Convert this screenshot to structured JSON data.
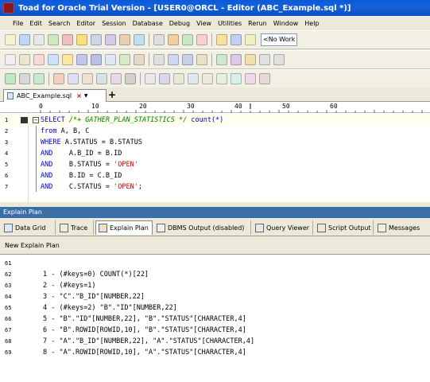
{
  "window": {
    "title": "Toad for Oracle Trial Version - [USER0@ORCL - Editor (ABC_Example.sql *)]"
  },
  "menu": [
    "File",
    "Edit",
    "Search",
    "Editor",
    "Session",
    "Database",
    "Debug",
    "View",
    "Utilities",
    "Rerun",
    "Window",
    "Help"
  ],
  "toolbar": {
    "workspace_label": "<No Work"
  },
  "document_tab": {
    "label": "ABC_Example.sql",
    "close_icon": "×",
    "dropdown": "▼",
    "add_label": "+"
  },
  "ruler": {
    "ticks": [
      "0",
      "10",
      "20",
      "30",
      "40",
      "50",
      "60"
    ]
  },
  "editor": {
    "lines": [
      {
        "n": "1",
        "segments": [
          {
            "t": "SELECT ",
            "c": "kw"
          },
          {
            "t": "/*+ GATHER_PLAN_STATISTICS */",
            "c": "cm"
          },
          {
            "t": " count(*)",
            "c": "kw"
          }
        ]
      },
      {
        "n": "2",
        "segments": [
          {
            "t": "from ",
            "c": "kw"
          },
          {
            "t": "A, B, C",
            "c": ""
          }
        ]
      },
      {
        "n": "3",
        "segments": [
          {
            "t": "WHERE ",
            "c": "kw"
          },
          {
            "t": "A.STATUS = B.STATUS",
            "c": ""
          }
        ]
      },
      {
        "n": "4",
        "segments": [
          {
            "t": "AND    ",
            "c": "kw"
          },
          {
            "t": "A.B_ID = B.ID",
            "c": ""
          }
        ]
      },
      {
        "n": "5",
        "segments": [
          {
            "t": "AND    ",
            "c": "kw"
          },
          {
            "t": "B.STATUS = ",
            "c": ""
          },
          {
            "t": "'OPEN'",
            "c": "str"
          }
        ]
      },
      {
        "n": "6",
        "segments": [
          {
            "t": "AND    ",
            "c": "kw"
          },
          {
            "t": "B.ID = C.B_ID",
            "c": ""
          }
        ]
      },
      {
        "n": "7",
        "segments": [
          {
            "t": "AND    ",
            "c": "kw"
          },
          {
            "t": "C.STATUS = ",
            "c": ""
          },
          {
            "t": "'OPEN'",
            "c": "str"
          },
          {
            "t": ";",
            "c": ""
          }
        ]
      }
    ]
  },
  "panel": {
    "title": "Explain Plan",
    "tabs": [
      "Data Grid",
      "Trace",
      "Explain Plan",
      "DBMS Output (disabled)",
      "Query Viewer",
      "Script Output",
      "Messages"
    ],
    "subheader": "New Explain Plan"
  },
  "output": {
    "lines": [
      {
        "n": "61",
        "text": ""
      },
      {
        "n": "62",
        "text": "1 - (#keys=0) COUNT(*)[22]"
      },
      {
        "n": "63",
        "text": "2 - (#keys=1)"
      },
      {
        "n": "64",
        "text": "3 - \"C\".\"B_ID\"[NUMBER,22]"
      },
      {
        "n": "65",
        "text": "4 - (#keys=2) \"B\".\"ID\"[NUMBER,22]"
      },
      {
        "n": "66",
        "text": "5 - \"B\".\"ID\"[NUMBER,22], \"B\".\"STATUS\"[CHARACTER,4]"
      },
      {
        "n": "67",
        "text": "6 - \"B\".ROWID[ROWID,10], \"B\".\"STATUS\"[CHARACTER,4]"
      },
      {
        "n": "68",
        "text": "7 - \"A\".\"B_ID\"[NUMBER,22], \"A\".\"STATUS\"[CHARACTER,4]"
      },
      {
        "n": "69",
        "text": "8 - \"A\".ROWID[ROWID,10], \"A\".\"STATUS\"[CHARACTER,4]"
      }
    ]
  }
}
